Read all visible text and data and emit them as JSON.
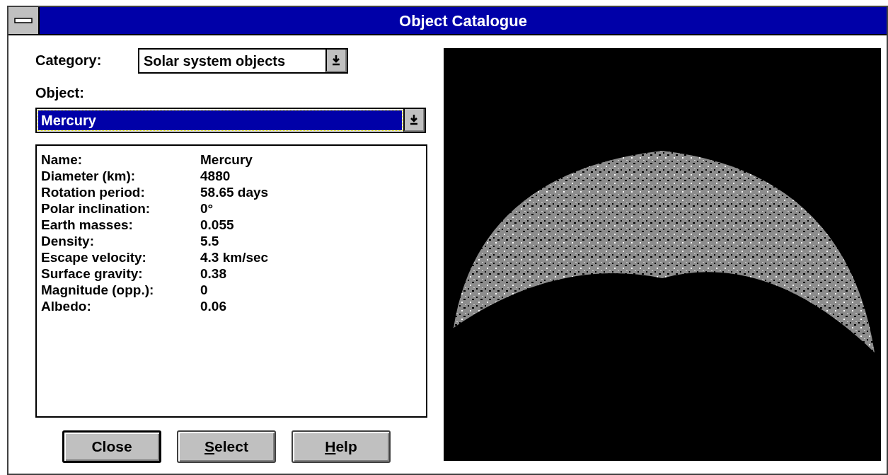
{
  "window": {
    "title": "Object Catalogue"
  },
  "category": {
    "label": "Category:",
    "value": "Solar system objects",
    "focused": false
  },
  "object": {
    "label": "Object:",
    "value": "Mercury",
    "focused": true
  },
  "details": [
    {
      "label": "Name:",
      "value": "Mercury"
    },
    {
      "label": "Diameter (km):",
      "value": "4880"
    },
    {
      "label": "Rotation period:",
      "value": "58.65 days"
    },
    {
      "label": "Polar inclination:",
      "value": "0°"
    },
    {
      "label": "Earth masses:",
      "value": "0.055"
    },
    {
      "label": "Density:",
      "value": "5.5"
    },
    {
      "label": "Escape velocity:",
      "value": "4.3 km/sec"
    },
    {
      "label": "Surface gravity:",
      "value": "0.38"
    },
    {
      "label": "Magnitude (opp.):",
      "value": "0"
    },
    {
      "label": "Albedo:",
      "value": "0.06"
    }
  ],
  "buttons": [
    {
      "label": "Close",
      "default": true,
      "underline_first": false
    },
    {
      "label": "Select",
      "default": false,
      "underline_first": true
    },
    {
      "label": "Help",
      "default": false,
      "underline_first": true
    }
  ]
}
